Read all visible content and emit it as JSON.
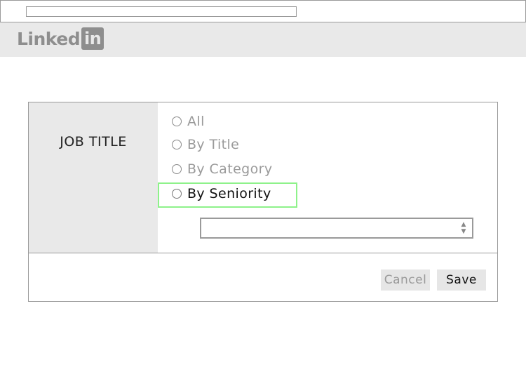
{
  "header": {
    "logo_text": "Linked",
    "logo_box_text": "in"
  },
  "dialog": {
    "section_label": "JOB TITLE",
    "options": [
      {
        "label": "All",
        "selected": false
      },
      {
        "label": "By Title",
        "selected": false
      },
      {
        "label": "By Category",
        "selected": false
      },
      {
        "label": "By Seniority",
        "selected": false,
        "highlighted": true
      }
    ],
    "select": {
      "value": ""
    },
    "buttons": {
      "cancel_label": "Cancel",
      "save_label": "Save"
    }
  },
  "colors": {
    "header_bg": "#e9e9e9",
    "highlight": "#8ef28a",
    "muted_text": "#9a9a9a",
    "dark_text": "#111111"
  },
  "icons": {
    "select_arrows": "updown-arrows-icon"
  }
}
